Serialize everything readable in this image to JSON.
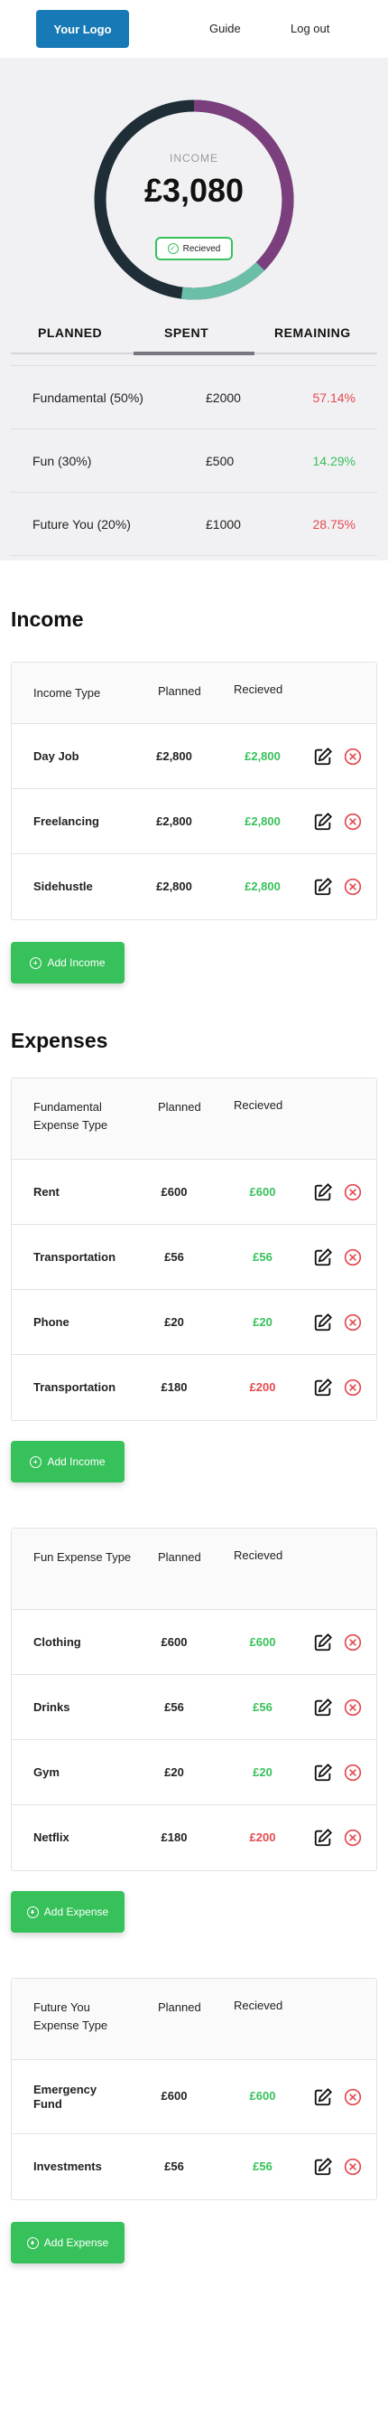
{
  "header": {
    "logo_label": "Your Logo",
    "nav": {
      "guide": "Guide",
      "logout": "Log out"
    }
  },
  "summary": {
    "donut": {
      "label": "INCOME",
      "value": "£3,080",
      "badge": "Recieved",
      "colors": {
        "dark": "#1e2d36",
        "purple": "#7b3f7d",
        "teal": "#6bbfa8"
      }
    },
    "tabs": {
      "planned": "PLANNED",
      "spent": "SPENT",
      "remaining": "REMAINING",
      "active": "SPENT"
    },
    "categories": [
      {
        "name": "Fundamental (50%)",
        "amount": "£2000",
        "pct": "57.14%",
        "status": "red"
      },
      {
        "name": "Fun (30%)",
        "amount": "£500",
        "pct": "14.29%",
        "status": "green"
      },
      {
        "name": "Future You (20%)",
        "amount": "£1000",
        "pct": "28.75%",
        "status": "red"
      }
    ]
  },
  "income": {
    "title": "Income",
    "headers": {
      "type": "Income Type",
      "planned": "Planned",
      "recieved": "Recieved"
    },
    "rows": [
      {
        "name": "Day Job",
        "planned": "£2,800",
        "recieved": "£2,800",
        "status": "green"
      },
      {
        "name": "Freelancing",
        "planned": "£2,800",
        "recieved": "£2,800",
        "status": "green"
      },
      {
        "name": "Sidehustle",
        "planned": "£2,800",
        "recieved": "£2,800",
        "status": "green"
      }
    ],
    "add_label": "Add Income"
  },
  "expenses": {
    "title": "Expenses",
    "groups": [
      {
        "headers": {
          "type": "Fundamental Expense Type",
          "planned": "Planned",
          "recieved": "Recieved"
        },
        "rows": [
          {
            "name": "Rent",
            "planned": "£600",
            "recieved": "£600",
            "status": "green"
          },
          {
            "name": "Transportation",
            "planned": "£56",
            "recieved": "£56",
            "status": "green"
          },
          {
            "name": "Phone",
            "planned": "£20",
            "recieved": "£20",
            "status": "green"
          },
          {
            "name": "Transportation",
            "planned": "£180",
            "recieved": "£200",
            "status": "red"
          }
        ],
        "add_label": "Add Income"
      },
      {
        "headers": {
          "type": "Fun Expense Type",
          "planned": "Planned",
          "recieved": "Recieved"
        },
        "rows": [
          {
            "name": "Clothing",
            "planned": "£600",
            "recieved": "£600",
            "status": "green"
          },
          {
            "name": "Drinks",
            "planned": "£56",
            "recieved": "£56",
            "status": "green"
          },
          {
            "name": "Gym",
            "planned": "£20",
            "recieved": "£20",
            "status": "green"
          },
          {
            "name": "Netflix",
            "planned": "£180",
            "recieved": "£200",
            "status": "red"
          }
        ],
        "add_label": "Add Expense"
      },
      {
        "headers": {
          "type": "Future You Expense Type",
          "planned": "Planned",
          "recieved": "Recieved"
        },
        "rows": [
          {
            "name": "Emergency Fund",
            "planned": "£600",
            "recieved": "£600",
            "status": "green"
          },
          {
            "name": "Investments",
            "planned": "£56",
            "recieved": "£56",
            "status": "green"
          }
        ],
        "add_label": "Add Expense"
      }
    ]
  },
  "icons": {
    "edit": "edit-icon",
    "delete": "delete-icon",
    "add": "plus-circle-icon",
    "check": "check-circle-icon"
  },
  "colors": {
    "brand": "#1779b6",
    "accent_green": "#37c15a",
    "danger_red": "#e5484d"
  }
}
